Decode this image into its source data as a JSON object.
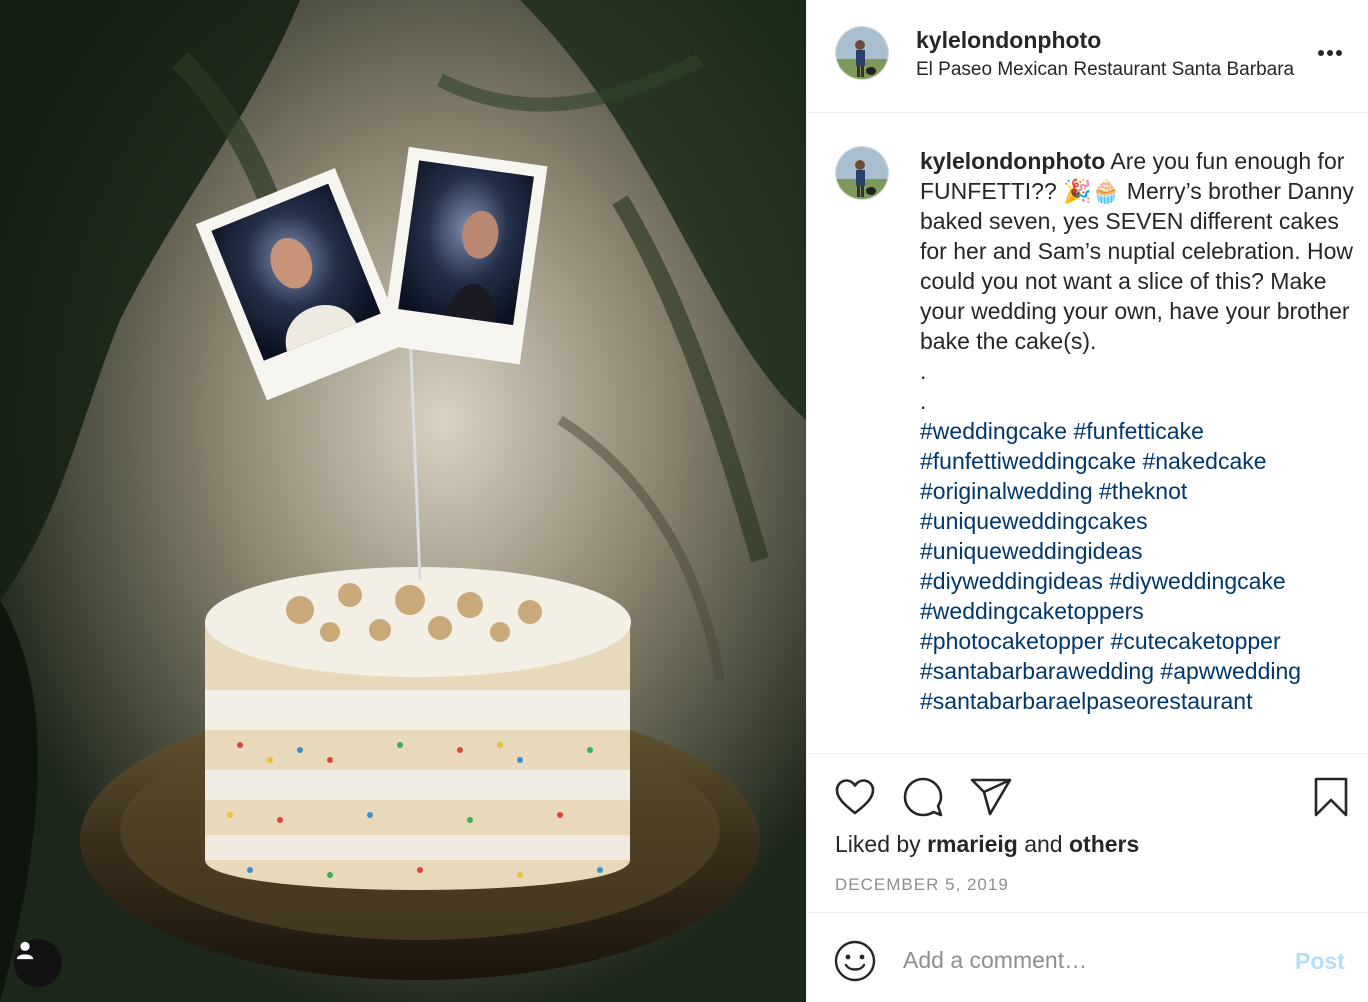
{
  "post": {
    "image_alt": "Funfetti wedding cake with instant photo cake topper",
    "user_tag_icon": "user-icon"
  },
  "header": {
    "username": "kylelondonphoto",
    "location": "El Paseo Mexican Restaurant Santa Barbara",
    "more_icon": "more-horizontal-icon"
  },
  "caption": {
    "username": "kylelondonphoto",
    "text_before_emoji": "Are you fun enough for FUNFETTI?? ",
    "emojis": "🎉🧁",
    "text_after_emoji": " Merry’s brother Danny baked seven, yes SEVEN different cakes for her and Sam’s nuptial celebration. How could you not want a slice of this? Make your wedding your own, have your brother bake the cake(s).",
    "dot1": ".",
    "dot2": ".",
    "hashtags": [
      "#weddingcake",
      "#funfetticake",
      "#funfettiweddingcake",
      "#nakedcake",
      "#originalwedding",
      "#theknot",
      "#uniqueweddingcakes",
      "#uniqueweddingideas",
      "#diyweddingideas",
      "#diyweddingcake",
      "#weddingcaketoppers",
      "#photocaketopper",
      "#cutecaketopper",
      "#santabarbarawedding",
      "#apwwedding",
      "#santabarbaraelpaseorestaurant"
    ]
  },
  "actions": {
    "like_icon": "heart-icon",
    "comment_icon": "comment-icon",
    "share_icon": "paper-plane-icon",
    "save_icon": "bookmark-icon"
  },
  "likes": {
    "prefix": "Liked by ",
    "user": "rmarieig",
    "middle": " and ",
    "others": "others"
  },
  "date": "DECEMBER 5, 2019",
  "comment": {
    "placeholder": "Add a comment…",
    "post_label": "Post",
    "emoji_icon": "smiley-icon"
  },
  "colors": {
    "hashtag": "#00376b",
    "post_disabled": "#b2dffc",
    "secondary_text": "#8e8e8e"
  }
}
